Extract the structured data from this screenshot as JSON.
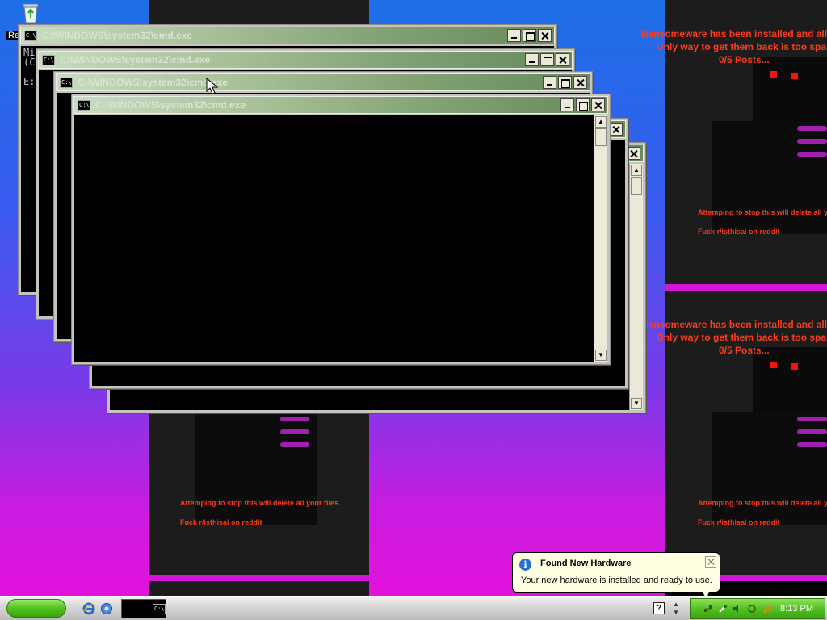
{
  "desktop": {
    "recycle_label": "Re",
    "ransom_note": {
      "line1": "Ransomeware has been installed and all c",
      "line2": "Only way to get them back is too spam",
      "line3": "0/5 Posts...",
      "warning": "Attemping to stop this will delete all your files.",
      "warning_cut": "Attemping to stop this will delete all y",
      "reddit": "Fuck r/isthisai on reddit"
    }
  },
  "console": {
    "title": "C:\\WINDOWS\\system32\\cmd.exe",
    "icon_text": "C:\\",
    "back_lines": [
      "Mi",
      "(C",
      "",
      "E:"
    ]
  },
  "balloon": {
    "title": "Found New Hardware",
    "message": "Your new hardware is installed and ready to use."
  },
  "taskbar": {
    "clock": "8:13 PM",
    "help_glyph": "?"
  },
  "colors": {
    "ransom_text": "#ff3a1a",
    "tray_green": "#4fbd1e",
    "wallpaper_magenta": "#d414d8"
  }
}
